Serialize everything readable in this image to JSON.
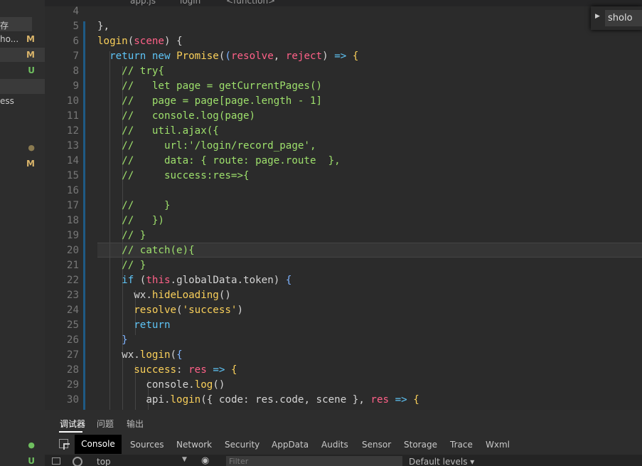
{
  "breadcrumb": {
    "items": [
      "app.js",
      "login",
      "<function>"
    ]
  },
  "sidebar": {
    "save_label": "存",
    "items": [
      {
        "name": "ho...",
        "status": "M",
        "status_color": "#d9b46a"
      },
      {
        "name": "",
        "status": "M",
        "status_color": "#d9b46a"
      },
      {
        "name": "",
        "status": "U",
        "status_color": "#6fbf5f"
      },
      {
        "name": "ess",
        "status": "",
        "status_color": ""
      },
      {
        "name": "",
        "status": "●",
        "status_color": "#8a7a50"
      },
      {
        "name": "",
        "status": "M",
        "status_color": "#d9b46a"
      },
      {
        "name": "",
        "status": "●",
        "status_color": "#6fbf5f"
      },
      {
        "name": "",
        "status": "U",
        "status_color": "#6fbf5f"
      }
    ]
  },
  "search": {
    "value": "sholo"
  },
  "editor": {
    "active_line": 20,
    "lines": [
      {
        "n": "4",
        "tokens": []
      },
      {
        "n": "5",
        "tokens": [
          [
            "pl",
            "},"
          ]
        ]
      },
      {
        "n": "6",
        "tokens": [
          [
            "fn",
            "login"
          ],
          [
            "pl",
            "("
          ],
          [
            "pr",
            "scene"
          ],
          [
            "pl",
            ") {"
          ]
        ]
      },
      {
        "n": "7",
        "tokens": [
          [
            "pl",
            "  "
          ],
          [
            "kw",
            "return new "
          ],
          [
            "fn",
            "Promise"
          ],
          [
            "pl",
            "("
          ],
          [
            "bb",
            "("
          ],
          [
            "pr",
            "resolve"
          ],
          [
            "pl",
            ", "
          ],
          [
            "pr",
            "reject"
          ],
          [
            "pl",
            ") "
          ],
          [
            "kw",
            "=>"
          ],
          [
            "pl",
            " "
          ],
          [
            "br",
            "{"
          ]
        ]
      },
      {
        "n": "8",
        "tokens": [
          [
            "pl",
            "    "
          ],
          [
            "cm",
            "// try{"
          ]
        ]
      },
      {
        "n": "9",
        "tokens": [
          [
            "pl",
            "    "
          ],
          [
            "cm",
            "//   let page = getCurrentPages()"
          ]
        ]
      },
      {
        "n": "10",
        "tokens": [
          [
            "pl",
            "    "
          ],
          [
            "cm",
            "//   page = page[page.length - 1]"
          ]
        ]
      },
      {
        "n": "11",
        "tokens": [
          [
            "pl",
            "    "
          ],
          [
            "cm",
            "//   console.log(page)"
          ]
        ]
      },
      {
        "n": "12",
        "tokens": [
          [
            "pl",
            "    "
          ],
          [
            "cm",
            "//   util.ajax({"
          ]
        ]
      },
      {
        "n": "13",
        "tokens": [
          [
            "pl",
            "    "
          ],
          [
            "cm",
            "//     url:'/login/record_page',"
          ]
        ]
      },
      {
        "n": "14",
        "tokens": [
          [
            "pl",
            "    "
          ],
          [
            "cm",
            "//     data: { route: page.route  },"
          ]
        ]
      },
      {
        "n": "15",
        "tokens": [
          [
            "pl",
            "    "
          ],
          [
            "cm",
            "//     success:res=>{"
          ]
        ]
      },
      {
        "n": "16",
        "tokens": []
      },
      {
        "n": "17",
        "tokens": [
          [
            "pl",
            "    "
          ],
          [
            "cm",
            "//     }"
          ]
        ]
      },
      {
        "n": "18",
        "tokens": [
          [
            "pl",
            "    "
          ],
          [
            "cm",
            "//   })"
          ]
        ]
      },
      {
        "n": "19",
        "tokens": [
          [
            "pl",
            "    "
          ],
          [
            "cm",
            "// }"
          ]
        ]
      },
      {
        "n": "20",
        "tokens": [
          [
            "pl",
            "    "
          ],
          [
            "cm",
            "// catch(e){"
          ]
        ]
      },
      {
        "n": "21",
        "tokens": [
          [
            "pl",
            "    "
          ],
          [
            "cm",
            "// }"
          ]
        ]
      },
      {
        "n": "22",
        "tokens": [
          [
            "pl",
            "    "
          ],
          [
            "kw",
            "if"
          ],
          [
            "pl",
            " ("
          ],
          [
            "pr",
            "this"
          ],
          [
            "pl",
            ".globalData.token) "
          ],
          [
            "bb",
            "{"
          ]
        ]
      },
      {
        "n": "23",
        "tokens": [
          [
            "pl",
            "      "
          ],
          [
            "pl",
            "wx."
          ],
          [
            "fn",
            "hideLoading"
          ],
          [
            "pl",
            "()"
          ]
        ]
      },
      {
        "n": "24",
        "tokens": [
          [
            "pl",
            "      "
          ],
          [
            "fn",
            "resolve"
          ],
          [
            "pl",
            "("
          ],
          [
            "st",
            "'success'"
          ],
          [
            "pl",
            ")"
          ]
        ]
      },
      {
        "n": "25",
        "tokens": [
          [
            "pl",
            "      "
          ],
          [
            "kw",
            "return"
          ]
        ]
      },
      {
        "n": "26",
        "tokens": [
          [
            "pl",
            "    "
          ],
          [
            "bb",
            "}"
          ]
        ]
      },
      {
        "n": "27",
        "tokens": [
          [
            "pl",
            "    "
          ],
          [
            "pl",
            "wx."
          ],
          [
            "fn",
            "login"
          ],
          [
            "pl",
            "("
          ],
          [
            "bb",
            "{"
          ]
        ]
      },
      {
        "n": "28",
        "tokens": [
          [
            "pl",
            "      "
          ],
          [
            "fn",
            "success"
          ],
          [
            "pl",
            ": "
          ],
          [
            "pr",
            "res"
          ],
          [
            "pl",
            " "
          ],
          [
            "kw",
            "=>"
          ],
          [
            "pl",
            " "
          ],
          [
            "br",
            "{"
          ]
        ]
      },
      {
        "n": "29",
        "tokens": [
          [
            "pl",
            "        "
          ],
          [
            "pl",
            "console."
          ],
          [
            "fn",
            "log"
          ],
          [
            "pl",
            "()"
          ]
        ]
      },
      {
        "n": "30",
        "tokens": [
          [
            "pl",
            "        "
          ],
          [
            "pl",
            "api."
          ],
          [
            "fn",
            "login"
          ],
          [
            "pl",
            "({ code: res.code, scene }, "
          ],
          [
            "pr",
            "res"
          ],
          [
            "pl",
            " "
          ],
          [
            "kw",
            "=>"
          ],
          [
            "pl",
            " "
          ],
          [
            "br",
            "{"
          ]
        ]
      }
    ]
  },
  "panel": {
    "tabs": [
      "调试器",
      "问题",
      "输出"
    ],
    "devtools_tabs": [
      "Console",
      "Sources",
      "Network",
      "Security",
      "AppData",
      "Audits",
      "Sensor",
      "Storage",
      "Trace",
      "Wxml"
    ],
    "context": "top",
    "filter_placeholder": "Filter",
    "levels": "Default levels ▾"
  }
}
